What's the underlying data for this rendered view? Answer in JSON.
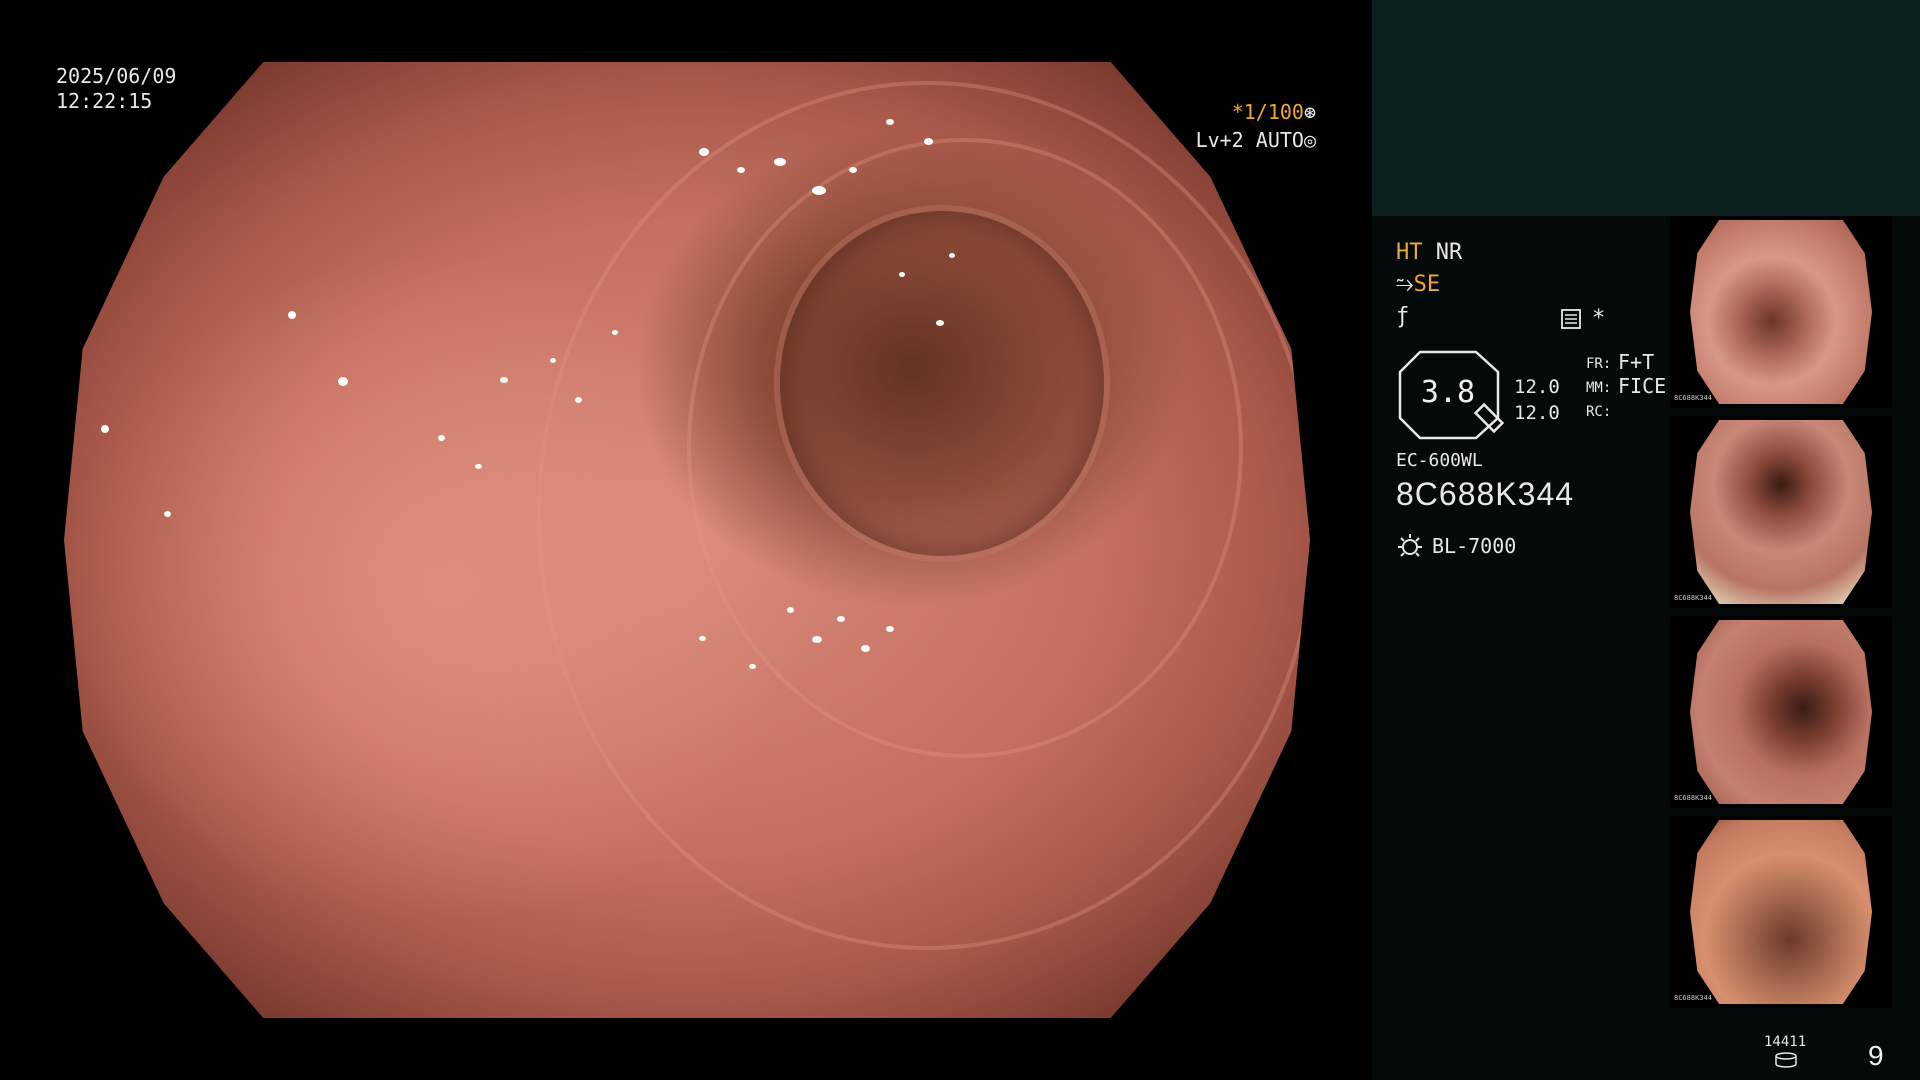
{
  "overlay": {
    "date": "2025/06/09",
    "time": "12:22:15",
    "shutter_speed": "*1/100",
    "brightness_level": "Lv+2",
    "iris_mode": "AUTO"
  },
  "processor_info": {
    "ht_label": "HT",
    "nr_label": "NR",
    "se_label": "SE",
    "zoom_value": "3.8",
    "num_top": "12.0",
    "num_bottom": "12.0",
    "fr_label": "FR:",
    "mm_label": "MM:",
    "rc_label": "RC:",
    "fr_value": "F+T",
    "mm_value": "FICE",
    "rc_value": "",
    "star": "*",
    "scope_model": "EC-600WL",
    "scope_serial": "8C688K344",
    "light_source": "BL-7000"
  },
  "storage": {
    "count": "14411",
    "page_number": "9"
  },
  "thumbnails": [
    {
      "mini_text": "8C688K344"
    },
    {
      "mini_text": "8C688K344"
    },
    {
      "mini_text": "8C688K344"
    },
    {
      "mini_text": "8C688K344"
    }
  ],
  "colors": {
    "accent_orange": "#f0a830",
    "panel_top": "#0b1f1f",
    "panel_bg": "#040a0a"
  }
}
